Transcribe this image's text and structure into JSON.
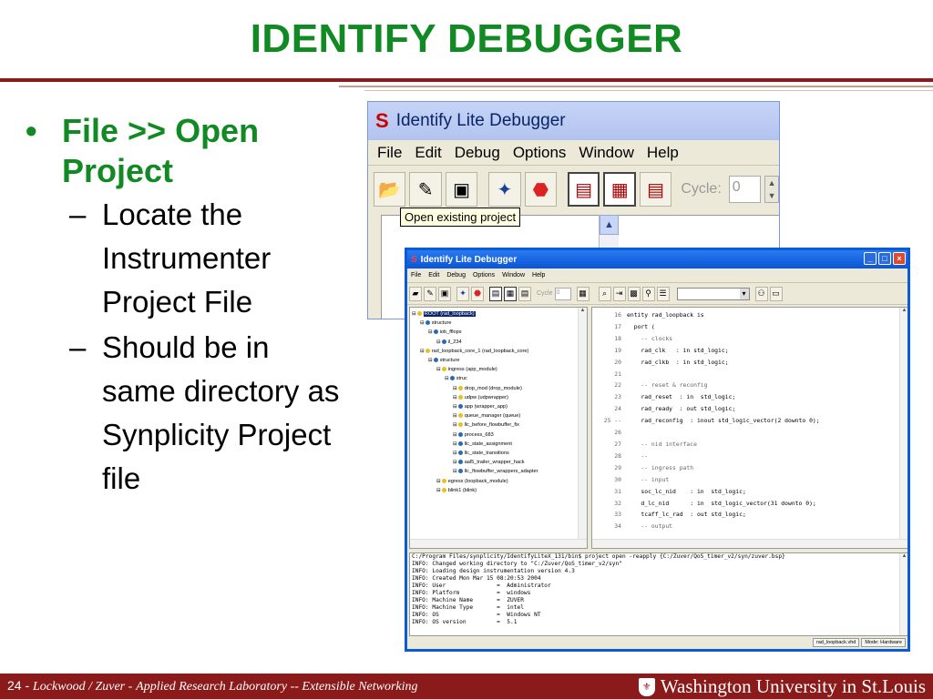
{
  "slide": {
    "title": "IDENTIFY DEBUGGER",
    "bullet_main": "File >> Open Project",
    "sub_bullets": [
      "Locate the Instrumenter Project File",
      "Should be in same directory as Synplicity Project file"
    ]
  },
  "back_window": {
    "title": "Identify Lite Debugger",
    "menu": [
      "File",
      "Edit",
      "Debug",
      "Options",
      "Window",
      "Help"
    ],
    "cycle_label": "Cycle:",
    "cycle_value": "0",
    "tooltip": "Open existing project"
  },
  "front_window": {
    "title": "Identify Lite Debugger",
    "menu": [
      "File",
      "Edit",
      "Debug",
      "Options",
      "Window",
      "Help"
    ],
    "cycle_label": "Cycle",
    "cycle_value": "0",
    "tree": [
      {
        "indent": 0,
        "icon": "y",
        "text": "ROOT (rad_loopback)",
        "selected": true
      },
      {
        "indent": 1,
        "icon": "b",
        "text": "structure"
      },
      {
        "indent": 2,
        "icon": "b",
        "text": "iob_fflops"
      },
      {
        "indent": 3,
        "icon": "b",
        "text": "il_234"
      },
      {
        "indent": 1,
        "icon": "y",
        "text": "rad_loopback_core_1 (rad_loopback_core)"
      },
      {
        "indent": 2,
        "icon": "b",
        "text": "structure"
      },
      {
        "indent": 3,
        "icon": "y",
        "text": "ingress (app_module)"
      },
      {
        "indent": 4,
        "icon": "b",
        "text": "struc"
      },
      {
        "indent": 5,
        "icon": "y",
        "text": "drop_mod (drop_module)"
      },
      {
        "indent": 5,
        "icon": "y",
        "text": "udpw (udpwrapper)"
      },
      {
        "indent": 5,
        "icon": "b",
        "text": "app (wrapper_app)"
      },
      {
        "indent": 5,
        "icon": "y",
        "text": "queue_manager (queue)"
      },
      {
        "indent": 5,
        "icon": "y",
        "text": "llc_before_flowbuffer_fix"
      },
      {
        "indent": 5,
        "icon": "b",
        "text": "process_683"
      },
      {
        "indent": 5,
        "icon": "b",
        "text": "llc_state_assignment"
      },
      {
        "indent": 5,
        "icon": "b",
        "text": "llc_state_transitions"
      },
      {
        "indent": 5,
        "icon": "b",
        "text": "aal5_trailer_wrapper_hack"
      },
      {
        "indent": 5,
        "icon": "b",
        "text": "llc_flowbuffer_wrappers_adapter"
      },
      {
        "indent": 3,
        "icon": "y",
        "text": "egress (loopback_module)"
      },
      {
        "indent": 3,
        "icon": "y",
        "text": "blink1 (blink)"
      }
    ],
    "code": [
      [
        "16",
        "entity rad_loopback is"
      ],
      [
        "17",
        "  port ("
      ],
      [
        "18",
        "    -- clocks"
      ],
      [
        "19",
        "    rad_clk   : in std_logic;"
      ],
      [
        "20",
        "    rad_clkb  : in std_logic;"
      ],
      [
        "21",
        ""
      ],
      [
        "22",
        "    -- reset & reconfig"
      ],
      [
        "23",
        "    rad_reset  : in  std_logic;"
      ],
      [
        "24",
        "    rad_ready  : out std_logic;"
      ],
      [
        "25 --",
        "    rad_reconfig  : inout std_logic_vector(2 downto 0);"
      ],
      [
        "26",
        ""
      ],
      [
        "27",
        "    -- nid interface"
      ],
      [
        "28",
        "    --"
      ],
      [
        "29",
        "    -- ingress path"
      ],
      [
        "30",
        "    -- input"
      ],
      [
        "31",
        "    soc_lc_nid    : in  std_logic;"
      ],
      [
        "32",
        "    d_lc_nid      : in  std_logic_vector(31 downto 0);"
      ],
      [
        "33",
        "    tcaff_lc_rad  : out std_logic;"
      ],
      [
        "34",
        "    -- output"
      ]
    ],
    "console": [
      "C:/Program Files/synplicity/IdentifyLiteX_131/bin$ project open -reapply {C:/Zuver/QoS_timer_v2/syn/zuver.bsp}",
      "INFO: Changed working directory to \"C:/Zuver/QoS_timer_v2/syn\"",
      "INFO: Loading design instrumentation version 4.3",
      "INFO: Created Mon Mar 15 08:20:53 2004",
      "INFO: User               =  Administrator",
      "INFO: Platform           =  windows",
      "INFO: Machine Name       =  ZUVER",
      "INFO: Machine Type       =  intel",
      "INFO: OS                 =  Windows NT",
      "INFO: OS version         =  5.1"
    ],
    "status_file": "rad_loopback.vhd",
    "status_mode": "Mode: Hardware"
  },
  "footer": {
    "page": "24 -",
    "authors": "Lockwood / Zuver -",
    "lab": "Applied Research Laboratory -- Extensible Networking",
    "university": "Washington University in St.Louis"
  }
}
